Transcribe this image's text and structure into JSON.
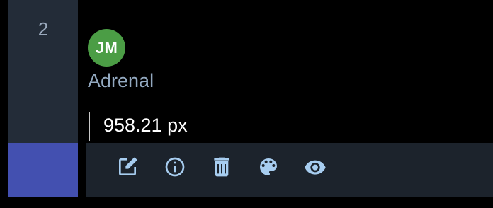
{
  "row": {
    "number": "2"
  },
  "user": {
    "initials": "JM"
  },
  "item": {
    "label": "Adrenal"
  },
  "measurement": {
    "value": "958.21 px"
  },
  "toolbar": {
    "icons": [
      "edit-icon",
      "info-icon",
      "delete-icon",
      "palette-icon",
      "visibility-icon"
    ]
  },
  "colors": {
    "background": "#000000",
    "left_column": "#232c38",
    "left_indicator": "#4350b0",
    "avatar": "#4b9d45",
    "label_text": "#93a9c0",
    "toolbar_bg": "#1c232c",
    "icon": "#a7cdf0"
  }
}
